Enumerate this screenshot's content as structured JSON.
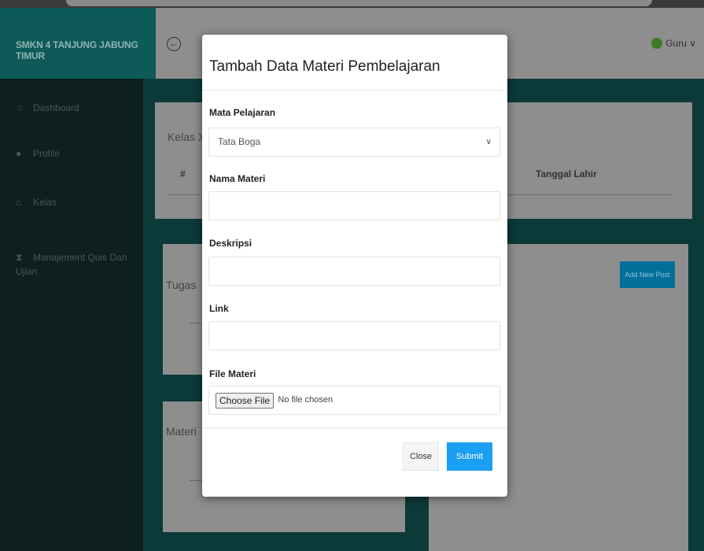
{
  "header": {
    "brand": "SMKN 4 TANJUNG JABUNG TIMUR",
    "back_icon": "arrow-left-circle-icon",
    "user_label": "Guru ∨"
  },
  "sidebar": {
    "items": [
      {
        "label": "Dashboard",
        "icon": "star-icon",
        "glyph": "☆"
      },
      {
        "label": "Profile",
        "icon": "user-icon",
        "glyph": "●"
      },
      {
        "label": "Kelas",
        "icon": "home-icon",
        "glyph": "⌂"
      },
      {
        "label": "Manajement Quis Dan Ujian",
        "icon": "hourglass-icon",
        "glyph": "⧗"
      }
    ]
  },
  "main": {
    "card1": {
      "title": "Kelas X",
      "col_num": "#",
      "col_date": "Tanggal Lahir"
    },
    "card2": {
      "title": "Tugas"
    },
    "card3": {
      "title": "Materi"
    },
    "add_button": "Add New Post"
  },
  "modal": {
    "title": "Tambah Data Materi Pembelajaran",
    "fields": {
      "mata_pelajaran": {
        "label": "Mata Pelajaran",
        "value": "Tata Boga"
      },
      "nama_materi": {
        "label": "Nama Materi",
        "value": ""
      },
      "deskripsi": {
        "label": "Deskripsi",
        "value": ""
      },
      "link": {
        "label": "Link",
        "value": ""
      },
      "file_materi": {
        "label": "File Materi",
        "button": "Choose File",
        "status": "No file chosen"
      }
    },
    "close_label": "Close",
    "submit_label": "Submit"
  }
}
